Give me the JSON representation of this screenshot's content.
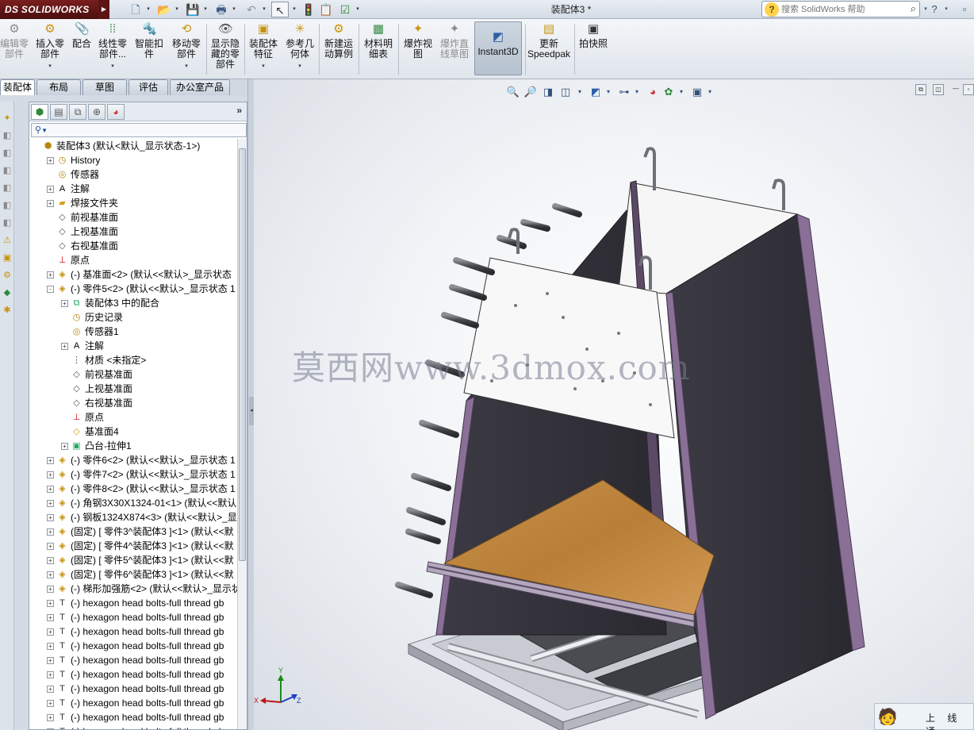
{
  "app": {
    "brand": "SOLIDWORKS",
    "brand_prefix": "DS",
    "document_title": "装配体3 *"
  },
  "help_search": {
    "placeholder": "搜索 SolidWorks 帮助"
  },
  "quick_access": [
    "new-doc-icon",
    "open-icon",
    "save-icon",
    "print-icon",
    "undo-icon",
    "select-icon",
    "rebuild-icon",
    "file-properties-icon",
    "options-icon"
  ],
  "command_manager": {
    "buttons": [
      {
        "label": "编辑零\n部件",
        "icon": "edit-component-icon",
        "enabled": false
      },
      {
        "label": "插入零\n部件",
        "icon": "insert-component-icon",
        "enabled": true
      },
      {
        "label": "配合",
        "icon": "mate-icon",
        "enabled": true
      },
      {
        "label": "线性零\n部件...",
        "icon": "linear-pattern-icon",
        "enabled": true
      },
      {
        "label": "智能扣\n件",
        "icon": "smart-fasteners-icon",
        "enabled": true
      },
      {
        "label": "移动零\n部件",
        "icon": "move-component-icon",
        "enabled": true
      },
      {
        "label": "显示隐\n藏的零\n部件",
        "icon": "show-hidden-icon",
        "enabled": true
      },
      {
        "label": "装配体\n特征",
        "icon": "assembly-features-icon",
        "enabled": true
      },
      {
        "label": "参考几\n何体",
        "icon": "reference-geometry-icon",
        "enabled": true
      },
      {
        "label": "新建运\n动算例",
        "icon": "motion-study-icon",
        "enabled": true
      },
      {
        "label": "材料明\n细表",
        "icon": "bom-icon",
        "enabled": true
      },
      {
        "label": "爆炸视\n图",
        "icon": "exploded-view-icon",
        "enabled": true
      },
      {
        "label": "爆炸直\n线草图",
        "icon": "explode-line-icon",
        "enabled": false
      },
      {
        "label": "Instant3D",
        "icon": "instant3d-icon",
        "enabled": true
      },
      {
        "label": "更新\nSpeedpak",
        "icon": "speedpak-icon",
        "enabled": true
      },
      {
        "label": "拍快照",
        "icon": "snapshot-icon",
        "enabled": true
      }
    ]
  },
  "tabs": [
    {
      "label": "装配体",
      "active": true
    },
    {
      "label": "布局",
      "active": false
    },
    {
      "label": "草图",
      "active": false
    },
    {
      "label": "评估",
      "active": false
    },
    {
      "label": "办公室产品",
      "active": false
    }
  ],
  "feature_tree": {
    "filter_label": "▼",
    "expand_label": "»",
    "items": [
      {
        "text": "装配体3  (默认<默认_显示状态-1>)",
        "level": 0,
        "toggle": "",
        "icon": "assembly-icon"
      },
      {
        "text": "History",
        "level": 1,
        "toggle": "+",
        "icon": "history-icon"
      },
      {
        "text": "传感器",
        "level": 1,
        "toggle": "",
        "icon": "sensor-icon"
      },
      {
        "text": "注解",
        "level": 1,
        "toggle": "+",
        "icon": "annotation-icon"
      },
      {
        "text": "焊接文件夹",
        "level": 1,
        "toggle": "+",
        "icon": "folder-icon"
      },
      {
        "text": "前视基准面",
        "level": 1,
        "toggle": "",
        "icon": "plane-icon"
      },
      {
        "text": "上视基准面",
        "level": 1,
        "toggle": "",
        "icon": "plane-icon"
      },
      {
        "text": "右视基准面",
        "level": 1,
        "toggle": "",
        "icon": "plane-icon"
      },
      {
        "text": "原点",
        "level": 1,
        "toggle": "",
        "icon": "origin-icon"
      },
      {
        "text": "(-) 基准面<2> (默认<<默认>_显示状态",
        "level": 1,
        "toggle": "+",
        "icon": "part-icon"
      },
      {
        "text": "(-) 零件5<2> (默认<<默认>_显示状态 1",
        "level": 1,
        "toggle": "-",
        "icon": "part-icon"
      },
      {
        "text": "装配体3 中的配合",
        "level": 2,
        "toggle": "+",
        "icon": "mate-folder-icon"
      },
      {
        "text": "历史记录",
        "level": 2,
        "toggle": "",
        "icon": "history-icon"
      },
      {
        "text": "传感器1",
        "level": 2,
        "toggle": "",
        "icon": "sensor-icon"
      },
      {
        "text": "注解",
        "level": 2,
        "toggle": "+",
        "icon": "annotation-icon"
      },
      {
        "text": "材质 <未指定>",
        "level": 2,
        "toggle": "",
        "icon": "material-icon"
      },
      {
        "text": "前视基准面",
        "level": 2,
        "toggle": "",
        "icon": "plane-icon"
      },
      {
        "text": "上视基准面",
        "level": 2,
        "toggle": "",
        "icon": "plane-icon"
      },
      {
        "text": "右视基准面",
        "level": 2,
        "toggle": "",
        "icon": "plane-icon"
      },
      {
        "text": "原点",
        "level": 2,
        "toggle": "",
        "icon": "origin-icon"
      },
      {
        "text": "基准面4",
        "level": 2,
        "toggle": "",
        "icon": "plane-yellow-icon"
      },
      {
        "text": "凸台-拉伸1",
        "level": 2,
        "toggle": "+",
        "icon": "extrude-icon"
      },
      {
        "text": "(-) 零件6<2> (默认<<默认>_显示状态 1",
        "level": 1,
        "toggle": "+",
        "icon": "part-icon"
      },
      {
        "text": "(-) 零件7<2> (默认<<默认>_显示状态 1",
        "level": 1,
        "toggle": "+",
        "icon": "part-icon"
      },
      {
        "text": "(-) 零件8<2> (默认<<默认>_显示状态 1",
        "level": 1,
        "toggle": "+",
        "icon": "part-icon"
      },
      {
        "text": "(-) 角钢3X30X1324-01<1> (默认<<默认",
        "level": 1,
        "toggle": "+",
        "icon": "part-icon"
      },
      {
        "text": "(-) 钢板1324X874<3> (默认<<默认>_显",
        "level": 1,
        "toggle": "+",
        "icon": "part-icon"
      },
      {
        "text": "(固定) [ 零件3^装配体3 ]<1> (默认<<默",
        "level": 1,
        "toggle": "+",
        "icon": "part-icon"
      },
      {
        "text": "(固定) [ 零件4^装配体3 ]<1> (默认<<默",
        "level": 1,
        "toggle": "+",
        "icon": "part-icon"
      },
      {
        "text": "(固定) [ 零件5^装配体3 ]<1> (默认<<默",
        "level": 1,
        "toggle": "+",
        "icon": "part-icon"
      },
      {
        "text": "(固定) [ 零件6^装配体3 ]<1> (默认<<默",
        "level": 1,
        "toggle": "+",
        "icon": "part-icon"
      },
      {
        "text": "(-) 梯形加强筋<2> (默认<<默认>_显示状",
        "level": 1,
        "toggle": "+",
        "icon": "part-icon"
      },
      {
        "text": "(-) hexagon head bolts-full thread gb",
        "level": 1,
        "toggle": "+",
        "icon": "bolt-icon"
      },
      {
        "text": "(-) hexagon head bolts-full thread gb",
        "level": 1,
        "toggle": "+",
        "icon": "bolt-icon"
      },
      {
        "text": "(-) hexagon head bolts-full thread gb",
        "level": 1,
        "toggle": "+",
        "icon": "bolt-icon"
      },
      {
        "text": "(-) hexagon head bolts-full thread gb",
        "level": 1,
        "toggle": "+",
        "icon": "bolt-icon"
      },
      {
        "text": "(-) hexagon head bolts-full thread gb",
        "level": 1,
        "toggle": "+",
        "icon": "bolt-icon"
      },
      {
        "text": "(-) hexagon head bolts-full thread gb",
        "level": 1,
        "toggle": "+",
        "icon": "bolt-icon"
      },
      {
        "text": "(-) hexagon head bolts-full thread gb",
        "level": 1,
        "toggle": "+",
        "icon": "bolt-icon"
      },
      {
        "text": "(-) hexagon head bolts-full thread gb",
        "level": 1,
        "toggle": "+",
        "icon": "bolt-icon"
      },
      {
        "text": "(-) hexagon head bolts-full thread gb",
        "level": 1,
        "toggle": "+",
        "icon": "bolt-icon"
      },
      {
        "text": "(-) hexagon head bolts-full thread gb",
        "level": 1,
        "toggle": "+",
        "icon": "bolt-icon"
      }
    ]
  },
  "viewport": {
    "watermark": "莫西网www.3dmox.com",
    "triad": {
      "x": "X",
      "y": "Y",
      "z": "Z"
    },
    "status_text": "上 线 通"
  }
}
